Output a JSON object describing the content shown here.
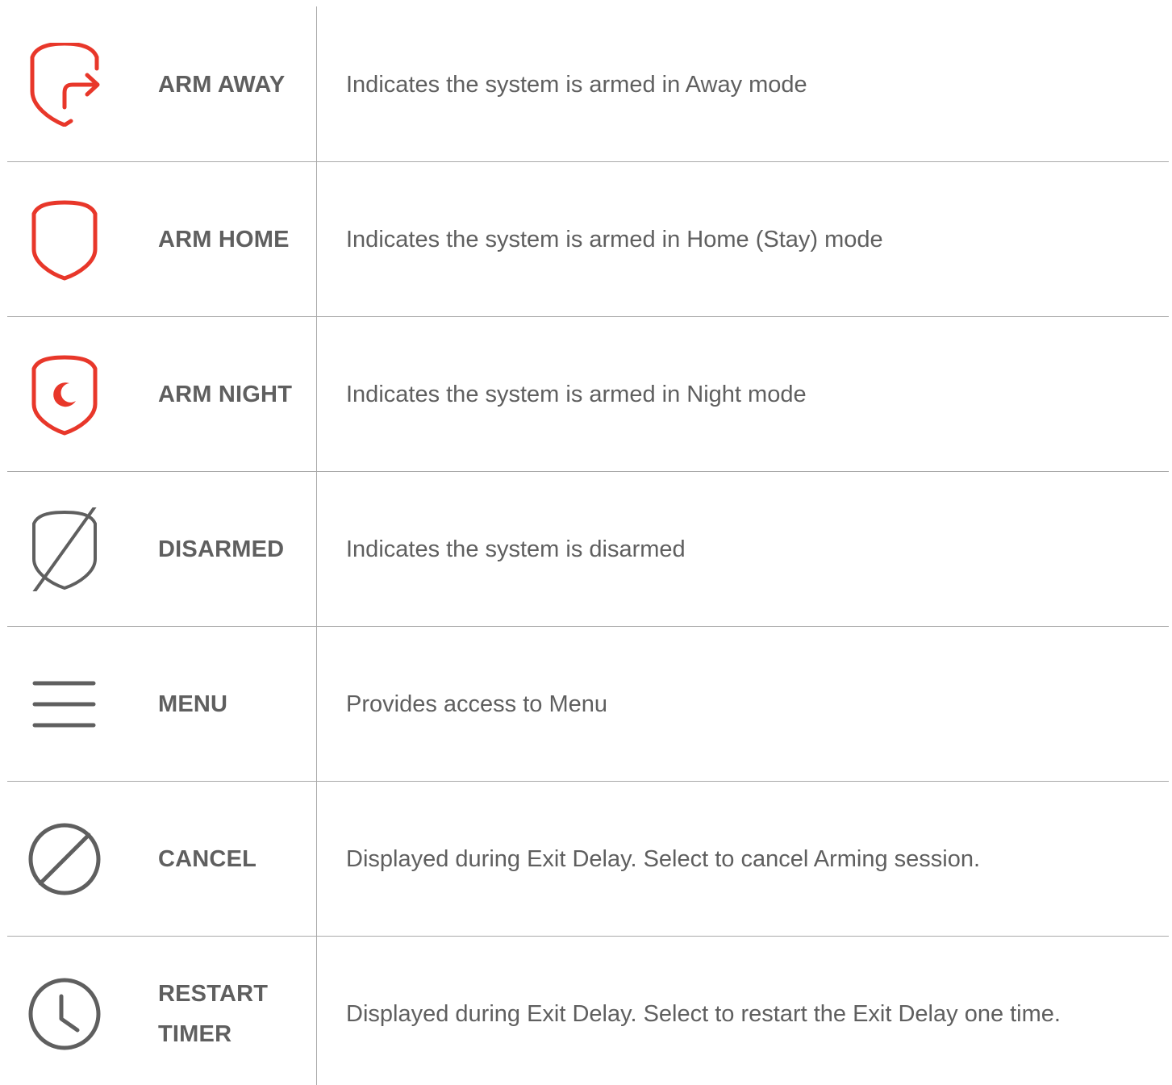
{
  "colors": {
    "accent_red": "#e8372a",
    "icon_gray": "#5f5f5f",
    "text_gray": "#5f5f5f",
    "rule_gray": "#a9a9a9"
  },
  "rows": [
    {
      "icon": "shield-exit-arrow-icon",
      "label": "ARM AWAY",
      "description": "Indicates the system is armed in Away mode"
    },
    {
      "icon": "shield-icon",
      "label": "ARM HOME",
      "description": "Indicates the system is armed in Home (Stay) mode"
    },
    {
      "icon": "shield-moon-icon",
      "label": "ARM NIGHT",
      "description": "Indicates the system is armed in Night mode"
    },
    {
      "icon": "shield-slash-icon",
      "label": "DISARMED",
      "description": "Indicates the system is disarmed"
    },
    {
      "icon": "hamburger-menu-icon",
      "label": "MENU",
      "description": "Provides access to Menu"
    },
    {
      "icon": "cancel-circle-slash-icon",
      "label": "CANCEL",
      "description": "Displayed during Exit Delay. Select to cancel Arming session."
    },
    {
      "icon": "clock-icon",
      "label_lines": [
        "RESTART",
        "TIMER"
      ],
      "description": "Displayed during Exit Delay. Select to restart the Exit Delay one time."
    }
  ]
}
